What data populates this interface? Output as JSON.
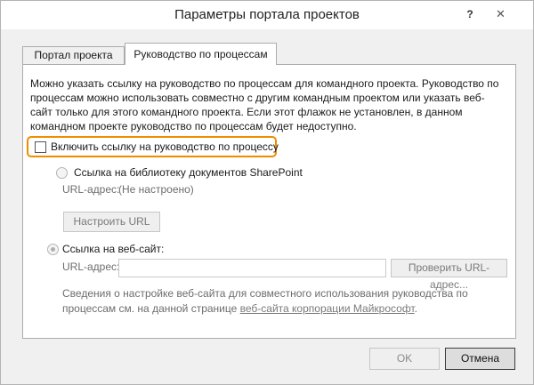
{
  "window": {
    "title": "Параметры портала проектов",
    "help_label": "?",
    "close_label": "✕"
  },
  "tabs": [
    {
      "label": "Портал проекта",
      "active": false
    },
    {
      "label": "Руководство по процессам",
      "active": true
    }
  ],
  "description": "Можно указать ссылку на руководство по процессам для командного проекта. Руководство по процессам можно использовать совместно с другим командным проектом или указать веб-сайт только для этого командного проекта. Если этот флажок не установлен, в данном командном проекте руководство по процессам будет недоступно.",
  "enable_checkbox": {
    "label": "Включить ссылку на руководство по процессу",
    "checked": false
  },
  "sharepoint_option": {
    "label": "Ссылка на библиотеку документов SharePoint",
    "url_label": "URL-адрес:",
    "url_value": "(Не настроено)",
    "configure_button": "Настроить URL"
  },
  "website_option": {
    "label": "Ссылка на веб-сайт:",
    "url_label": "URL-адрес:",
    "url_value": "",
    "verify_button": "Проверить URL-адрес..."
  },
  "info": {
    "text_before": "Сведения о настройке веб-сайта для совместного использования руководства по процессам см. на данной странице ",
    "link_text": "веб-сайта корпорации Майкрософт",
    "text_after": "."
  },
  "footer": {
    "ok_label": "OK",
    "cancel_label": "Отмена"
  },
  "colors": {
    "highlight": "#f08c00",
    "panel": "#ffffff",
    "window": "#f0f0f0"
  }
}
